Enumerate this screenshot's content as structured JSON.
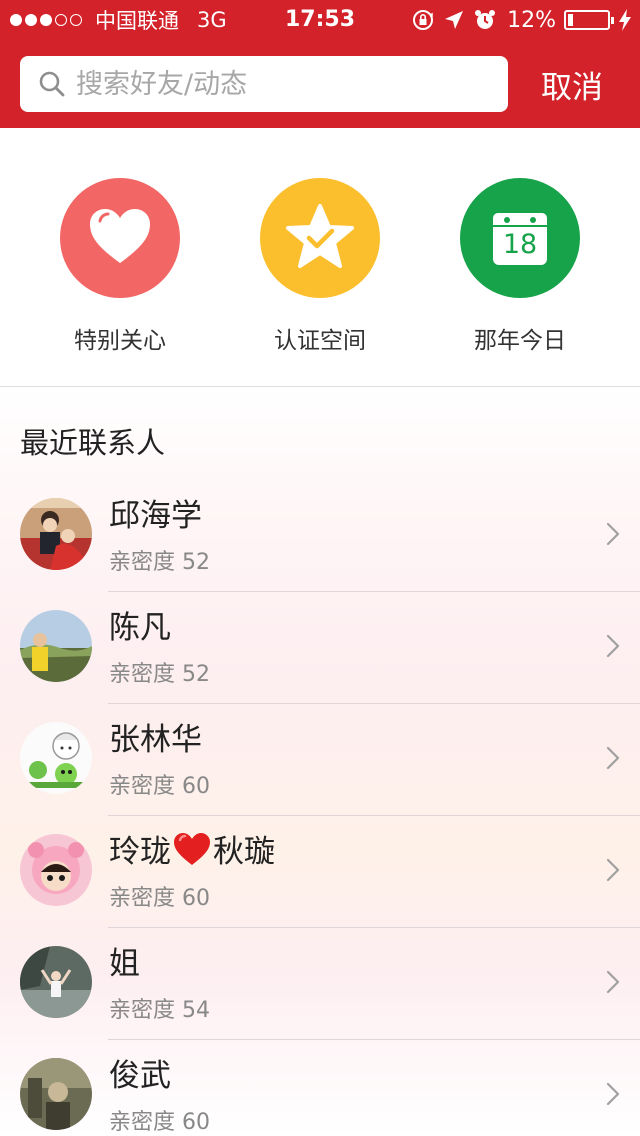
{
  "status_bar": {
    "signal_dots": [
      true,
      true,
      true,
      false,
      false
    ],
    "carrier": "中国联通",
    "network": "3G",
    "time": "17:53",
    "icons": [
      "orientation-lock-icon",
      "location-arrow-icon",
      "alarm-icon"
    ],
    "battery_percent_text": "12%",
    "battery_level": 0.12,
    "charging_icon": "bolt-icon"
  },
  "search": {
    "placeholder": "搜索好友/动态",
    "value": "",
    "cancel_label": "取消"
  },
  "features": [
    {
      "label": "特别关心",
      "icon": "heart-icon",
      "color": "#f26765"
    },
    {
      "label": "认证空间",
      "icon": "star-check-icon",
      "color": "#fbbf2e"
    },
    {
      "label": "那年今日",
      "icon": "calendar-icon",
      "calendar_day": "18",
      "color": "#17a34a"
    }
  ],
  "recent": {
    "title": "最近联系人",
    "intimacy_label": "亲密度",
    "contacts": [
      {
        "name": "邱海学",
        "intimacy": "亲密度 52"
      },
      {
        "name": "陈凡",
        "intimacy": "亲密度 52"
      },
      {
        "name": "张林华",
        "intimacy": "亲密度 60"
      },
      {
        "name_part1": "玲珑",
        "name_emoji": "red-heart-emoji",
        "name_part2": "秋璇",
        "intimacy": "亲密度 60"
      },
      {
        "name": "姐",
        "intimacy": "亲密度 54"
      },
      {
        "name": "俊武",
        "intimacy": "亲密度 60"
      }
    ]
  },
  "colors": {
    "brand_red": "#d3222a",
    "text_primary": "#222222",
    "text_secondary": "#888888"
  }
}
